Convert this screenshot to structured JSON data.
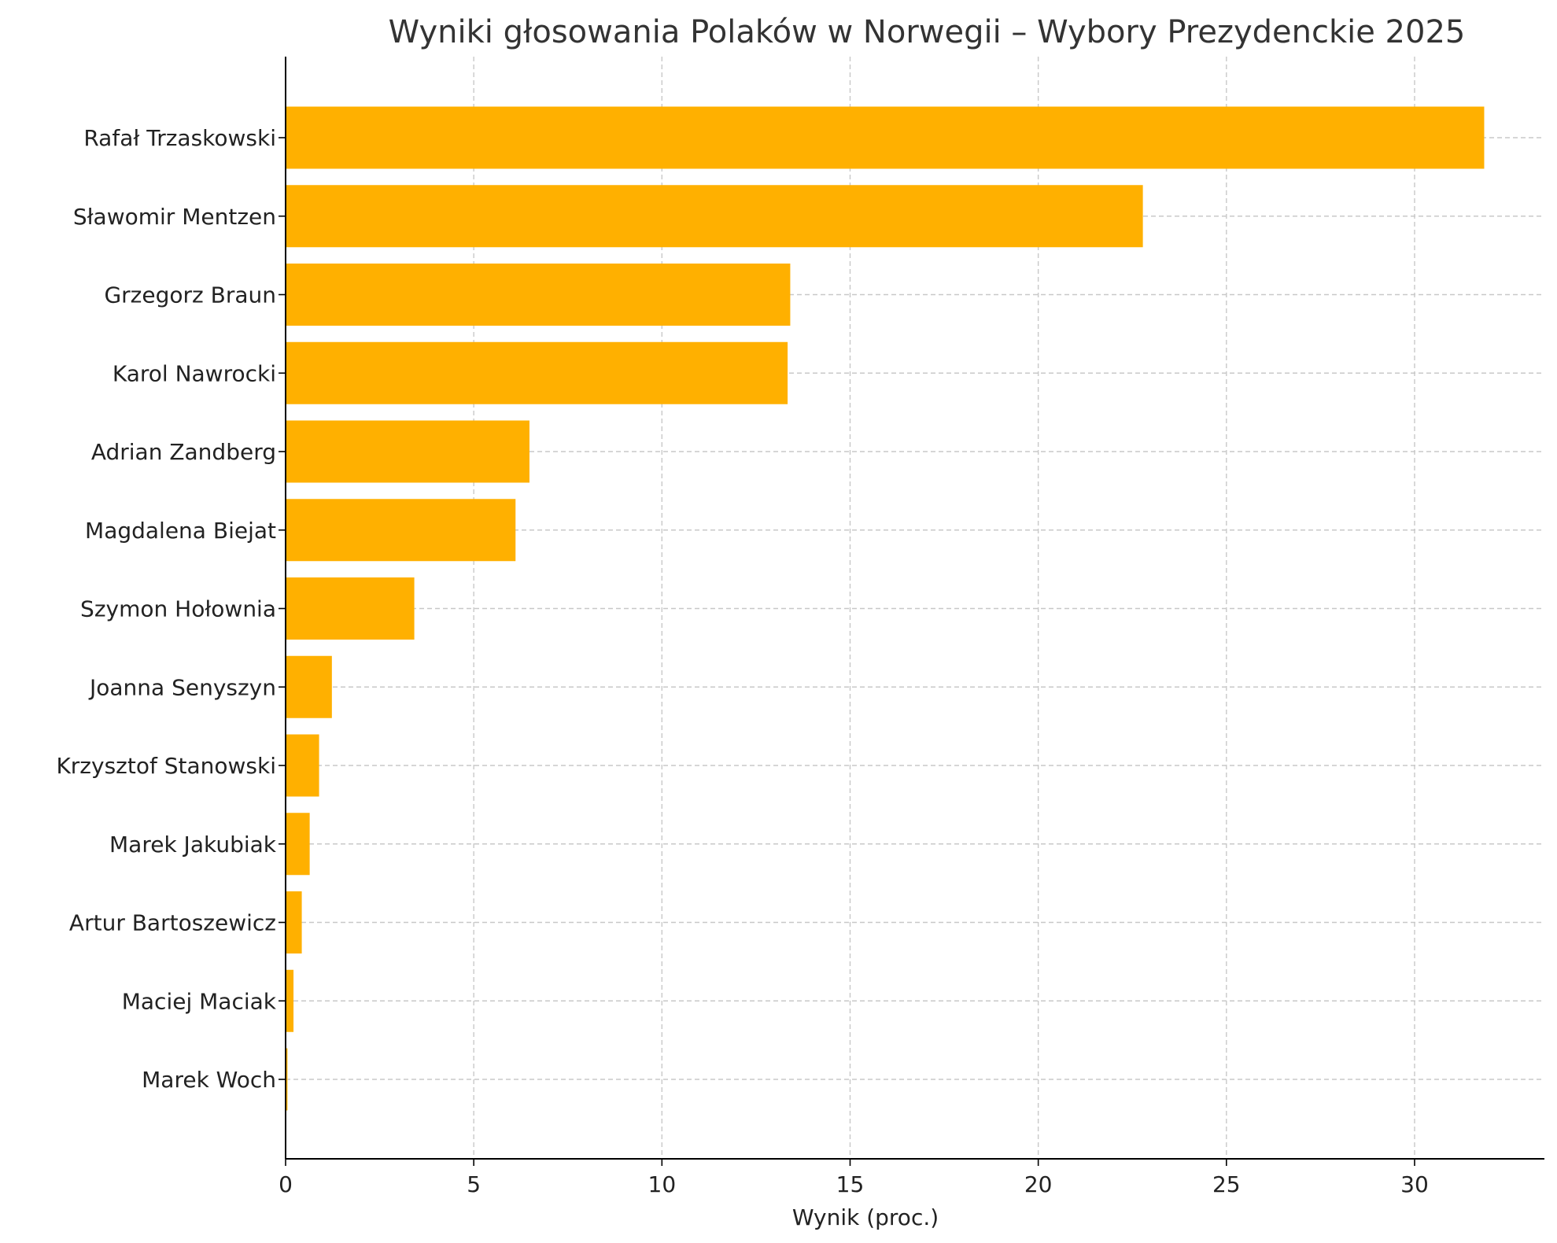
{
  "chart_data": {
    "type": "bar",
    "orientation": "horizontal",
    "title": "Wyniki głosowania Polaków w Norwegii – Wybory Prezydenckie 2025",
    "xlabel": "Wynik (proc.)",
    "ylabel": "",
    "xlim": [
      0,
      33.45
    ],
    "x_ticks": [
      0,
      5,
      10,
      15,
      20,
      25,
      30
    ],
    "grid": true,
    "bar_color": "#FFB000",
    "categories": [
      "Rafał Trzaskowski",
      "Sławomir Mentzen",
      "Grzegorz Braun",
      "Karol Nawrocki",
      "Adrian Zandberg",
      "Magdalena Biejat",
      "Szymon Hołownia",
      "Joanna Senyszyn",
      "Krzysztof Stanowski",
      "Marek Jakubiak",
      "Artur Bartoszewicz",
      "Maciej Maciak",
      "Marek Woch"
    ],
    "values": [
      31.85,
      22.78,
      13.41,
      13.34,
      6.48,
      6.11,
      3.42,
      1.23,
      0.89,
      0.64,
      0.43,
      0.21,
      0.05
    ]
  }
}
